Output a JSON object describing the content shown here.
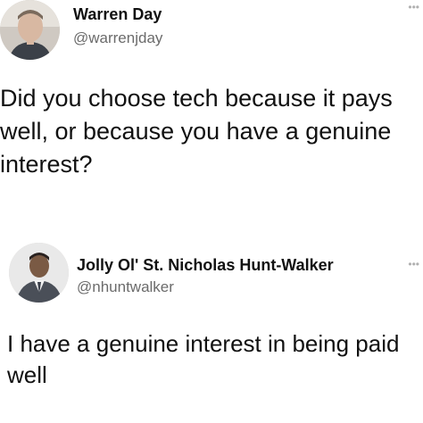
{
  "tweets": [
    {
      "author": {
        "name": "Warren Day",
        "handle": "@warrenjday"
      },
      "text": "Did you choose tech because it pays\nwell, or because you have a genuine\ninterest?"
    },
    {
      "author": {
        "name": "Jolly Ol' St. Nicholas Hunt-Walker",
        "handle": "@nhuntwalker"
      },
      "text": "I have a genuine interest in being paid\nwell"
    }
  ],
  "icons": {
    "more": "more-horizontal-icon",
    "more_glyph": "•••"
  }
}
